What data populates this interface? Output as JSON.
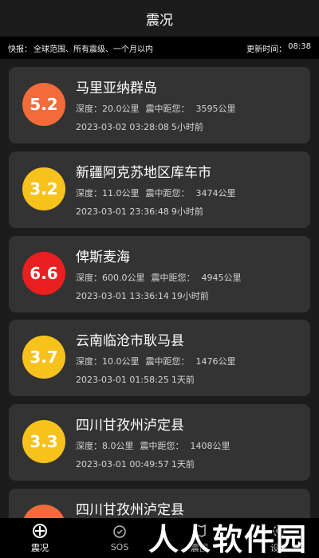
{
  "header": {
    "title": "震况"
  },
  "filter": {
    "label": "快报：",
    "value": "全球范围、所有震级、一个月以内",
    "update_label": "更新时间：",
    "update_time": "08:38"
  },
  "labels": {
    "depth": "深度：",
    "distance": "震中距您："
  },
  "quakes": [
    {
      "mag": "5.2",
      "color": "#f26b3a",
      "place": "马里亚纳群岛",
      "depth": "20.0公里",
      "distance": "3595公里",
      "datetime": "2023-03-02 03:28:08",
      "ago": "5小时前"
    },
    {
      "mag": "3.2",
      "color": "#f8c21c",
      "place": "新疆阿克苏地区库车市",
      "depth": "11.0公里",
      "distance": "3474公里",
      "datetime": "2023-03-01 23:36:48",
      "ago": "9小时前"
    },
    {
      "mag": "6.6",
      "color": "#ea1f1f",
      "place": "俾斯麦海",
      "depth": "600.0公里",
      "distance": "4945公里",
      "datetime": "2023-03-01 13:36:14",
      "ago": "19小时前"
    },
    {
      "mag": "3.7",
      "color": "#f8c21c",
      "place": "云南临沧市耿马县",
      "depth": "10.0公里",
      "distance": "1476公里",
      "datetime": "2023-03-01 01:58:25",
      "ago": "1天前"
    },
    {
      "mag": "3.3",
      "color": "#f8c21c",
      "place": "四川甘孜州泸定县",
      "depth": "8.0公里",
      "distance": "1408公里",
      "datetime": "2023-03-01 00:49:57",
      "ago": "1天前"
    },
    {
      "mag": "",
      "color": "#f26b3a",
      "place": "四川甘孜州泸定县",
      "depth": "",
      "distance": "",
      "datetime": "",
      "ago": ""
    }
  ],
  "tabs": [
    {
      "label": "震况",
      "icon": "quake-icon"
    },
    {
      "label": "SOS",
      "icon": "sos-icon"
    },
    {
      "label": "震图",
      "icon": "map-icon"
    },
    {
      "label": "设置",
      "icon": "settings-icon"
    }
  ],
  "watermark": "人人软件园"
}
